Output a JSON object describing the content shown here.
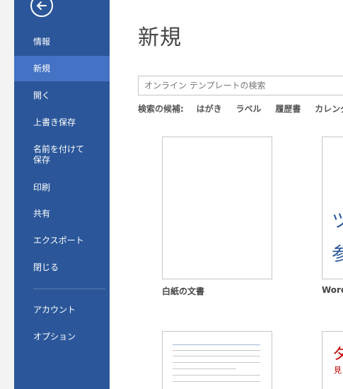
{
  "sidebar": {
    "back_icon": "arrow-left-icon",
    "items": [
      {
        "label": "情報"
      },
      {
        "label": "新規"
      },
      {
        "label": "開く"
      },
      {
        "label": "上書き保存"
      },
      {
        "label": "名前を付けて\n保存"
      },
      {
        "label": "印刷"
      },
      {
        "label": "共有"
      },
      {
        "label": "エクスポート"
      },
      {
        "label": "閉じる"
      },
      {
        "label": "アカウント"
      },
      {
        "label": "オプション"
      }
    ],
    "active_index": 1,
    "colors": {
      "background": "#2b579a",
      "active": "#4472c4"
    }
  },
  "main": {
    "title": "新規",
    "search": {
      "placeholder": "オンライン テンプレートの検索"
    },
    "suggestions": {
      "label": "検索の候補:",
      "items": [
        "はがき",
        "ラベル",
        "履歴書",
        "カレンダー"
      ]
    },
    "templates": [
      {
        "caption": "白紙の文書"
      },
      {
        "caption": "Word",
        "preview_lines": [
          "ツ",
          "参"
        ]
      },
      {
        "caption": ""
      },
      {
        "caption": "",
        "preview_lines": [
          "タ",
          "見"
        ]
      }
    ]
  }
}
